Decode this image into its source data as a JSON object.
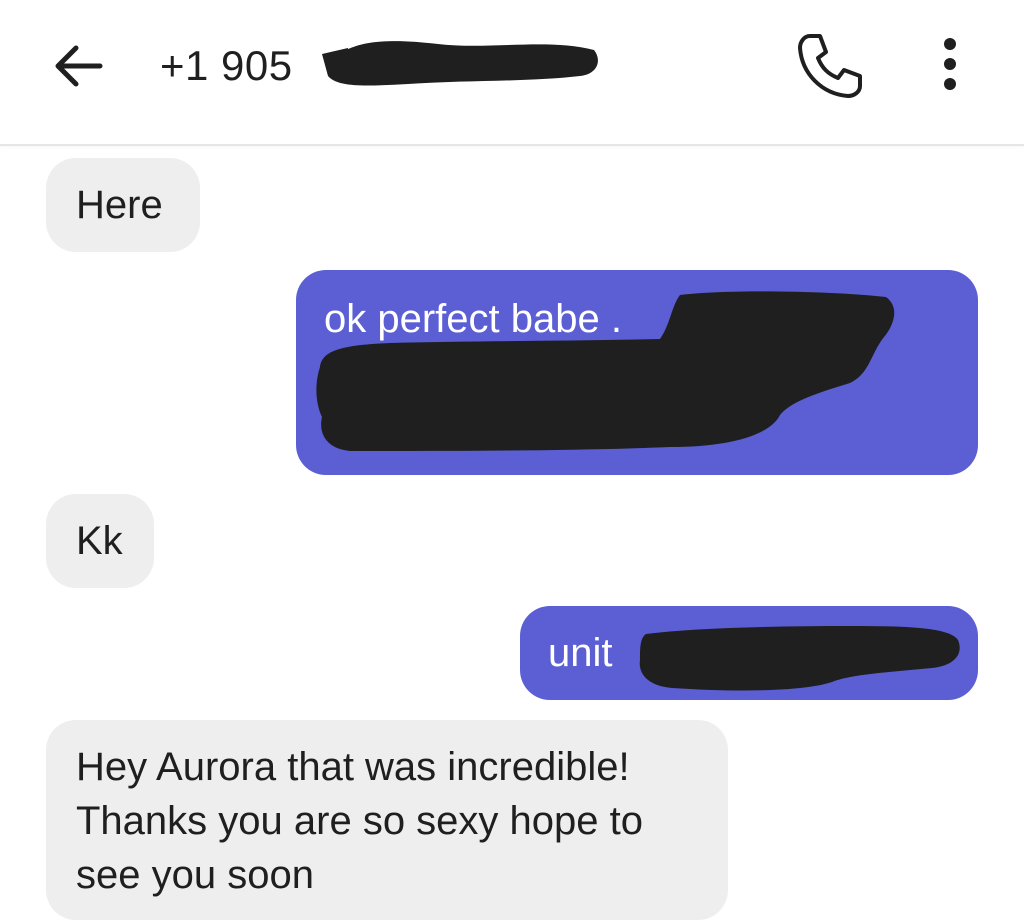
{
  "header": {
    "back_icon": "arrow-left-icon",
    "contact_number": "+1 905",
    "call_icon": "phone-icon",
    "more_icon": "more-vertical-icon"
  },
  "conversation": {
    "messages": [
      {
        "direction": "incoming",
        "text": "Here"
      },
      {
        "direction": "outgoing",
        "text": "ok perfect babe ."
      },
      {
        "direction": "incoming",
        "text": "Kk"
      },
      {
        "direction": "outgoing",
        "text": "unit"
      },
      {
        "direction": "incoming",
        "text": "Hey Aurora that was incredible!  Thanks you are so sexy hope to see you soon"
      }
    ]
  },
  "colors": {
    "outgoing_bubble": "#5b5fd3",
    "incoming_bubble": "#eeeeee",
    "redaction": "#1f1f1f"
  }
}
